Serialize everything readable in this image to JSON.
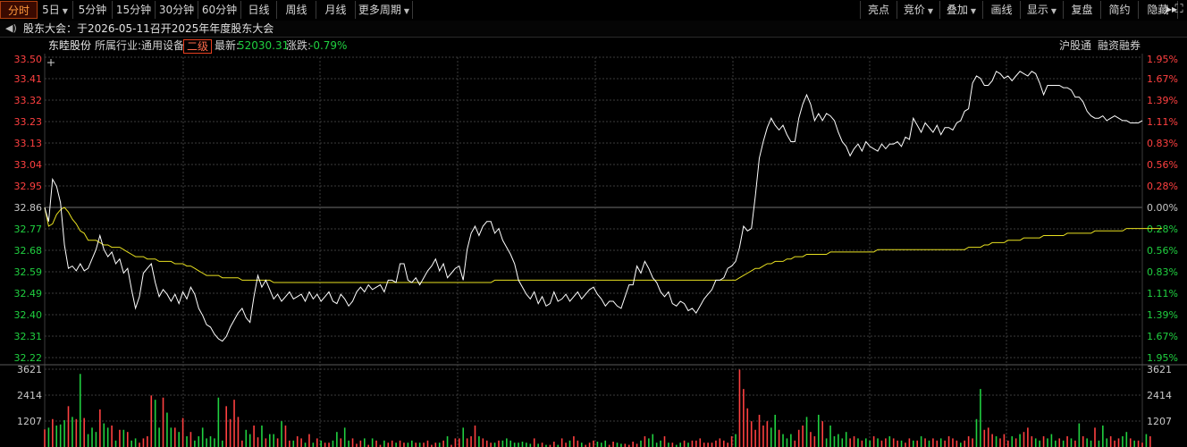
{
  "toolbar": {
    "periods": [
      {
        "label": "分时",
        "active": true,
        "dropdown": false
      },
      {
        "label": "5日",
        "dropdown": true
      },
      {
        "label": "5分钟",
        "dropdown": false
      },
      {
        "label": "15分钟",
        "dropdown": false
      },
      {
        "label": "30分钟",
        "dropdown": false
      },
      {
        "label": "60分钟",
        "dropdown": false
      },
      {
        "label": "日线",
        "dropdown": false
      },
      {
        "label": "周线",
        "dropdown": false
      },
      {
        "label": "月线",
        "dropdown": false
      },
      {
        "label": "更多周期",
        "dropdown": true
      }
    ],
    "tools": [
      {
        "label": "亮点",
        "dropdown": false
      },
      {
        "label": "竞价",
        "dropdown": true
      },
      {
        "label": "叠加",
        "dropdown": true
      },
      {
        "label": "画线",
        "dropdown": false
      },
      {
        "label": "显示",
        "dropdown": true
      },
      {
        "label": "复盘",
        "dropdown": false
      },
      {
        "label": "简约",
        "dropdown": false
      },
      {
        "label": "隐藏",
        "dropdown": false
      }
    ]
  },
  "notice": {
    "icon": "speaker-icon",
    "text": "股东大会：于2026-05-11召开2025年年度股东大会"
  },
  "info": {
    "stock_name": "东睦股份",
    "industry_label": "所属行业:",
    "industry": "通用设备",
    "level": "二级",
    "latest_label": "最新:",
    "latest": "52030.31",
    "change_label": "涨跌:",
    "change": "-0.79%",
    "link1": "沪股通",
    "link2": "融资融券"
  },
  "colors": {
    "up": "#ff4040",
    "down": "#20d040",
    "price_line": "#ffffff",
    "avg_line": "#e8e020",
    "grid": "#3c3c3c",
    "grid_mid": "#707070"
  },
  "chart_data": {
    "type": "line",
    "price_ticks": [
      "33.50",
      "33.41",
      "33.32",
      "33.23",
      "33.13",
      "33.04",
      "32.95",
      "32.86",
      "32.77",
      "32.68",
      "32.59",
      "32.49",
      "32.40",
      "32.31",
      "32.22"
    ],
    "pct_ticks": [
      "1.95%",
      "1.67%",
      "1.39%",
      "1.11%",
      "0.83%",
      "0.56%",
      "0.28%",
      "0.00%",
      "0.28%",
      "0.56%",
      "0.83%",
      "1.11%",
      "1.39%",
      "1.67%",
      "1.95%"
    ],
    "ylim": [
      32.22,
      33.5
    ],
    "prev_close": 32.86,
    "volume_ticks": [
      "3621",
      "2414",
      "1207"
    ],
    "volume_max": 3621,
    "price": [
      32.86,
      32.8,
      32.98,
      32.95,
      32.88,
      32.7,
      32.6,
      32.61,
      32.59,
      32.62,
      32.59,
      32.6,
      32.64,
      32.68,
      32.74,
      32.68,
      32.65,
      32.67,
      32.62,
      32.64,
      32.58,
      32.6,
      32.51,
      32.43,
      32.48,
      32.58,
      32.6,
      32.62,
      32.54,
      32.48,
      32.51,
      32.49,
      32.46,
      32.49,
      32.45,
      32.5,
      32.47,
      32.52,
      32.49,
      32.43,
      32.4,
      32.36,
      32.35,
      32.32,
      32.3,
      32.29,
      32.31,
      32.35,
      32.38,
      32.41,
      32.43,
      32.39,
      32.37,
      32.48,
      32.57,
      32.52,
      32.55,
      32.51,
      32.47,
      32.49,
      32.46,
      32.48,
      32.5,
      32.47,
      32.48,
      32.49,
      32.46,
      32.5,
      32.47,
      32.49,
      32.46,
      32.48,
      32.5,
      32.46,
      32.45,
      32.49,
      32.47,
      32.44,
      32.46,
      32.5,
      32.52,
      32.5,
      32.53,
      32.51,
      32.52,
      32.53,
      32.5,
      32.55,
      32.55,
      32.54,
      32.62,
      32.62,
      32.55,
      32.54,
      32.56,
      32.53,
      32.56,
      32.59,
      32.61,
      32.64,
      32.59,
      32.62,
      32.56,
      32.58,
      32.6,
      32.61,
      32.55,
      32.68,
      32.75,
      32.78,
      32.74,
      32.78,
      32.8,
      32.8,
      32.75,
      32.77,
      32.72,
      32.69,
      32.66,
      32.62,
      32.55,
      32.52,
      32.49,
      32.47,
      32.5,
      32.45,
      32.48,
      32.44,
      32.45,
      32.5,
      32.46,
      32.47,
      32.49,
      32.46,
      32.48,
      32.5,
      32.47,
      32.49,
      32.51,
      32.52,
      32.49,
      32.47,
      32.44,
      32.46,
      32.46,
      32.44,
      32.43,
      32.48,
      32.53,
      32.53,
      32.61,
      32.58,
      32.63,
      32.6,
      32.56,
      32.54,
      32.5,
      32.48,
      32.5,
      32.45,
      32.44,
      32.46,
      32.45,
      32.42,
      32.43,
      32.41,
      32.44,
      32.47,
      32.49,
      32.51,
      32.55,
      32.55,
      32.56,
      32.6,
      32.61,
      32.63,
      32.69,
      32.78,
      32.76,
      32.77,
      32.91,
      33.07,
      33.14,
      33.2,
      33.24,
      33.21,
      33.19,
      33.21,
      33.17,
      33.14,
      33.14,
      33.24,
      33.3,
      33.34,
      33.3,
      33.23,
      33.26,
      33.23,
      33.26,
      33.25,
      33.23,
      33.18,
      33.14,
      33.12,
      33.08,
      33.11,
      33.13,
      33.1,
      33.14,
      33.12,
      33.11,
      33.1,
      33.13,
      33.11,
      33.13,
      33.13,
      33.14,
      33.12,
      33.16,
      33.15,
      33.24,
      33.21,
      33.18,
      33.22,
      33.2,
      33.18,
      33.21,
      33.17,
      33.2,
      33.2,
      33.19,
      33.22,
      33.23,
      33.27,
      33.28,
      33.39,
      33.42,
      33.41,
      33.38,
      33.38,
      33.4,
      33.44,
      33.43,
      33.41,
      33.42,
      33.4,
      33.42,
      33.44,
      33.43,
      33.42,
      33.44,
      33.43,
      33.39,
      33.34,
      33.38,
      33.38,
      33.38,
      33.38,
      33.37,
      33.37,
      33.36,
      33.33,
      33.33,
      33.31,
      33.27,
      33.25,
      33.24,
      33.24,
      33.25,
      33.23,
      33.24,
      33.25,
      33.24,
      33.23,
      33.23,
      33.22,
      33.22,
      33.22,
      33.23
    ],
    "avg": [
      32.86,
      32.78,
      32.79,
      32.83,
      32.85,
      32.86,
      32.84,
      32.81,
      32.79,
      32.76,
      32.75,
      32.72,
      32.72,
      32.72,
      32.71,
      32.7,
      32.7,
      32.69,
      32.69,
      32.69,
      32.68,
      32.67,
      32.66,
      32.65,
      32.65,
      32.65,
      32.64,
      32.64,
      32.64,
      32.63,
      32.63,
      32.63,
      32.63,
      32.62,
      32.62,
      32.62,
      32.61,
      32.61,
      32.6,
      32.59,
      32.58,
      32.57,
      32.57,
      32.57,
      32.57,
      32.56,
      32.56,
      32.56,
      32.56,
      32.56,
      32.55,
      32.55,
      32.55,
      32.55,
      32.55,
      32.55,
      32.55,
      32.55,
      32.54,
      32.54,
      32.54,
      32.54,
      32.54,
      32.54,
      32.54,
      32.54,
      32.54,
      32.54,
      32.54,
      32.54,
      32.54,
      32.54,
      32.54,
      32.54,
      32.54,
      32.54,
      32.54,
      32.54,
      32.54,
      32.54,
      32.54,
      32.54,
      32.54,
      32.54,
      32.54,
      32.54,
      32.54,
      32.54,
      32.54,
      32.54,
      32.54,
      32.54,
      32.54,
      32.54,
      32.54,
      32.54,
      32.54,
      32.54,
      32.54,
      32.54,
      32.54,
      32.54,
      32.54,
      32.54,
      32.54,
      32.54,
      32.54,
      32.54,
      32.54,
      32.54,
      32.54,
      32.54,
      32.54,
      32.54,
      32.55,
      32.55,
      32.55,
      32.55,
      32.55,
      32.55,
      32.55,
      32.55,
      32.55,
      32.55,
      32.55,
      32.55,
      32.55,
      32.55,
      32.55,
      32.55,
      32.55,
      32.55,
      32.55,
      32.55,
      32.55,
      32.55,
      32.55,
      32.55,
      32.55,
      32.55,
      32.55,
      32.55,
      32.55,
      32.55,
      32.55,
      32.55,
      32.55,
      32.55,
      32.55,
      32.55,
      32.55,
      32.55,
      32.55,
      32.55,
      32.55,
      32.55,
      32.55,
      32.55,
      32.55,
      32.55,
      32.55,
      32.55,
      32.55,
      32.55,
      32.55,
      32.55,
      32.55,
      32.55,
      32.55,
      32.55,
      32.55,
      32.55,
      32.55,
      32.55,
      32.55,
      32.55,
      32.56,
      32.57,
      32.58,
      32.59,
      32.6,
      32.6,
      32.61,
      32.62,
      32.62,
      32.63,
      32.63,
      32.63,
      32.64,
      32.64,
      32.65,
      32.65,
      32.65,
      32.66,
      32.66,
      32.66,
      32.66,
      32.66,
      32.66,
      32.67,
      32.67,
      32.67,
      32.67,
      32.67,
      32.67,
      32.67,
      32.67,
      32.67,
      32.67,
      32.67,
      32.67,
      32.68,
      32.68,
      32.68,
      32.68,
      32.68,
      32.68,
      32.68,
      32.68,
      32.68,
      32.68,
      32.68,
      32.68,
      32.68,
      32.68,
      32.68,
      32.68,
      32.68,
      32.68,
      32.68,
      32.68,
      32.68,
      32.68,
      32.68,
      32.69,
      32.69,
      32.69,
      32.69,
      32.7,
      32.7,
      32.71,
      32.71,
      32.71,
      32.71,
      32.72,
      32.72,
      32.72,
      32.72,
      32.73,
      32.73,
      32.73,
      32.73,
      32.73,
      32.74,
      32.74,
      32.74,
      32.74,
      32.74,
      32.74,
      32.75,
      32.75,
      32.75,
      32.75,
      32.75,
      32.75,
      32.75,
      32.76,
      32.76,
      32.76,
      32.76,
      32.76,
      32.76,
      32.76,
      32.76,
      32.77,
      32.77,
      32.77,
      32.77,
      32.77,
      32.77,
      32.77,
      32.77,
      32.77,
      32.77
    ],
    "volume": [
      820,
      900,
      1300,
      1000,
      1050,
      1250,
      1900,
      1400,
      1300,
      3400,
      1350,
      600,
      900,
      700,
      1750,
      1100,
      900,
      1000,
      300,
      800,
      800,
      700,
      300,
      400,
      200,
      400,
      500,
      2400,
      2200,
      900,
      2300,
      1600,
      900,
      900,
      700,
      1350,
      500,
      700,
      300,
      500,
      900,
      400,
      500,
      400,
      2300,
      300,
      1900,
      1300,
      2200,
      1400,
      300,
      800,
      600,
      1000,
      450,
      1000,
      400,
      600,
      600,
      400,
      1200,
      1000,
      300,
      300,
      500,
      400,
      200,
      600,
      200,
      400,
      300,
      200,
      200,
      300,
      700,
      400,
      900,
      300,
      400,
      150,
      300,
      400,
      100,
      400,
      300,
      100,
      300,
      200,
      300,
      200,
      300,
      200,
      200,
      300,
      200,
      200,
      200,
      300,
      100,
      200,
      200,
      300,
      500,
      100,
      400,
      400,
      900,
      400,
      500,
      1000,
      500,
      400,
      300,
      200,
      200,
      300,
      300,
      400,
      300,
      200,
      200,
      250,
      200,
      150,
      400,
      150,
      200,
      100,
      100,
      250,
      100,
      400,
      200,
      300,
      500,
      300,
      200,
      100,
      200,
      300,
      250,
      200,
      300,
      100,
      250,
      200,
      150,
      150,
      100,
      250,
      150,
      300,
      500,
      400,
      600,
      200,
      300,
      500,
      200,
      200,
      100,
      200,
      300,
      200,
      300,
      300,
      400,
      200,
      200,
      200,
      300,
      400,
      300,
      200,
      500,
      600,
      3600,
      2700,
      1800,
      1200,
      800,
      1500,
      1000,
      1200,
      900,
      1500,
      800,
      600,
      400,
      600,
      300,
      800,
      1000,
      1400,
      700,
      500,
      1500,
      1200,
      400,
      1000,
      500,
      600,
      400,
      700,
      400,
      500,
      400,
      300,
      400,
      300,
      500,
      400,
      300,
      400,
      500,
      400,
      300,
      300,
      200,
      400,
      300,
      300,
      500,
      400,
      300,
      400,
      300,
      400,
      300,
      500,
      400,
      300,
      200,
      300,
      500,
      400,
      1300,
      2700,
      800,
      900,
      600,
      500,
      400,
      600,
      300,
      500,
      400,
      600,
      700,
      900,
      500,
      400,
      300,
      500,
      400,
      600,
      300,
      400,
      300,
      500,
      400,
      300,
      1100,
      500,
      400,
      300,
      900,
      300,
      1000,
      400,
      500,
      300,
      400,
      500,
      700,
      400,
      300,
      300,
      200,
      600,
      500
    ],
    "vol_dir": [
      1,
      0,
      1,
      0,
      0,
      0,
      1,
      0,
      1,
      0,
      1,
      0,
      0,
      0,
      1,
      0,
      0,
      1,
      0,
      1,
      0,
      1,
      0,
      0,
      1,
      1,
      1,
      1,
      0,
      0,
      1,
      0,
      0,
      1,
      0,
      1,
      0,
      1,
      0,
      0,
      0,
      0,
      0,
      0,
      0,
      0,
      1,
      1,
      1,
      1,
      1,
      0,
      0,
      1,
      1,
      0,
      1,
      0,
      0,
      1,
      0,
      1,
      1,
      0,
      1,
      1,
      0,
      1,
      0,
      1,
      0,
      1,
      1,
      0,
      0,
      1,
      0,
      0,
      1,
      1,
      1,
      0,
      1,
      0,
      1,
      1,
      0,
      1,
      1,
      0,
      1,
      1,
      0,
      0,
      1,
      0,
      1,
      1,
      1,
      1,
      0,
      1,
      0,
      1,
      1,
      1,
      0,
      1,
      1,
      1,
      0,
      1,
      1,
      1,
      0,
      1,
      0,
      0,
      0,
      0,
      0,
      0,
      0,
      0,
      1,
      0,
      1,
      0,
      1,
      1,
      0,
      1,
      1,
      0,
      1,
      1,
      0,
      1,
      1,
      1,
      0,
      0,
      0,
      1,
      1,
      0,
      0,
      1,
      1,
      1,
      1,
      0,
      1,
      0,
      0,
      0,
      0,
      1,
      0,
      1,
      0,
      0,
      1,
      0,
      1,
      1,
      1,
      1,
      1,
      1,
      1,
      1,
      1,
      1,
      1,
      0,
      1,
      1,
      1,
      1,
      1,
      1,
      1,
      1,
      0,
      0,
      1,
      0,
      0,
      0,
      1,
      1,
      1,
      0,
      1,
      1,
      0,
      1,
      0,
      0,
      0,
      0,
      0,
      0,
      1,
      1,
      0,
      1,
      0,
      0,
      1,
      0,
      1,
      1,
      0,
      1,
      1,
      0,
      1,
      1,
      0,
      1,
      0,
      1,
      0,
      1,
      1,
      0,
      1,
      1,
      1,
      1,
      0,
      1,
      1,
      1,
      0,
      0,
      1,
      1,
      1,
      0,
      1,
      1,
      1,
      0,
      1,
      0,
      1,
      1,
      1,
      0,
      0,
      1,
      0,
      0,
      0,
      1,
      0,
      1,
      0,
      1,
      0,
      1,
      0,
      0,
      1,
      0,
      0,
      0,
      1,
      1,
      1,
      0,
      0,
      1,
      0,
      1,
      1,
      0,
      1,
      1,
      0,
      0,
      0,
      0,
      0,
      0,
      1,
      1
    ]
  }
}
